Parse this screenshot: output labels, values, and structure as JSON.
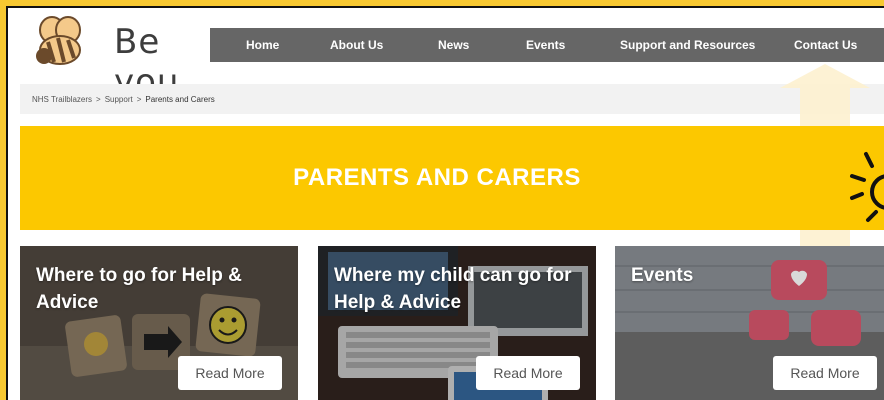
{
  "brand": {
    "name": "Be you",
    "logo_icon": "bee-icon"
  },
  "nav": {
    "items": [
      "Home",
      "About Us",
      "News",
      "Events",
      "Support and Resources",
      "Contact Us"
    ]
  },
  "breadcrumb": {
    "items": [
      "NHS Trailblazers",
      "Support",
      "Parents and Carers"
    ],
    "separator": ">"
  },
  "hero": {
    "title": "PARENTS AND CARERS"
  },
  "cards": [
    {
      "title_line1": "Where to go for Help &",
      "title_line2": "Advice",
      "button": "Read More"
    },
    {
      "title_line1": "Where my child can go for",
      "title_line2": "Help & Advice",
      "button": "Read More"
    },
    {
      "title_line1": "Events",
      "title_line2": "",
      "button": "Read More"
    }
  ],
  "colors": {
    "page_bg": "#f7c831",
    "nav_bg": "#666666",
    "hero_bg": "#fcc800",
    "text_dark": "#3d3d3d"
  }
}
